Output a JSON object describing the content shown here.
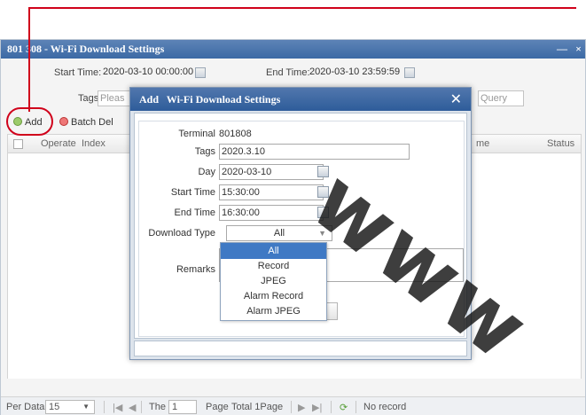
{
  "window": {
    "title": "801808 - Wi-Fi Download Settings",
    "title_visible": "801 308 - Wi-Fi Download Settings",
    "min_icon": "—",
    "close_icon": "×"
  },
  "filters": {
    "start_time_label": "Start Time:",
    "start_time_value": "2020-03-10 00:00:00",
    "end_time_label": "End Time:",
    "end_time_value": "2020-03-10 23:59:59",
    "tags_label": "Tags:",
    "tags_placeholder": "Pleas",
    "query_label": "Query"
  },
  "toolbar": {
    "add_label": "Add",
    "batch_del_label": "Batch Del"
  },
  "grid": {
    "columns": [
      "Operate",
      "Index",
      "me",
      "Status"
    ]
  },
  "pager": {
    "per_data_label": "Per Data",
    "per_data_value": "15",
    "the_label": "The",
    "page_value": "1",
    "page_label": "Page",
    "total_label": "Total 1Page",
    "status": "No record"
  },
  "dialog": {
    "title": "Add   Wi-Fi Download Settings",
    "close": "✕",
    "terminal_label": "Terminal",
    "terminal_value": "801808",
    "tags_label": "Tags",
    "tags_value": "2020.3.10",
    "day_label": "Day",
    "day_value": "2020-03-10",
    "start_time_label": "Start Time",
    "start_time_value": "15:30:00",
    "end_time_label": "End Time",
    "end_time_value": "16:30:00",
    "download_type_label": "Download Type",
    "download_type_value": "All",
    "remarks_label": "Remarks"
  },
  "dropdown": {
    "options": [
      "All",
      "Record",
      "JPEG",
      "Alarm Record",
      "Alarm JPEG"
    ],
    "selected": "All"
  },
  "watermark": "www",
  "colors": {
    "annotation": "#d0021b",
    "title_bar": "#3c6aa5",
    "selected_option": "#3f79c4"
  }
}
